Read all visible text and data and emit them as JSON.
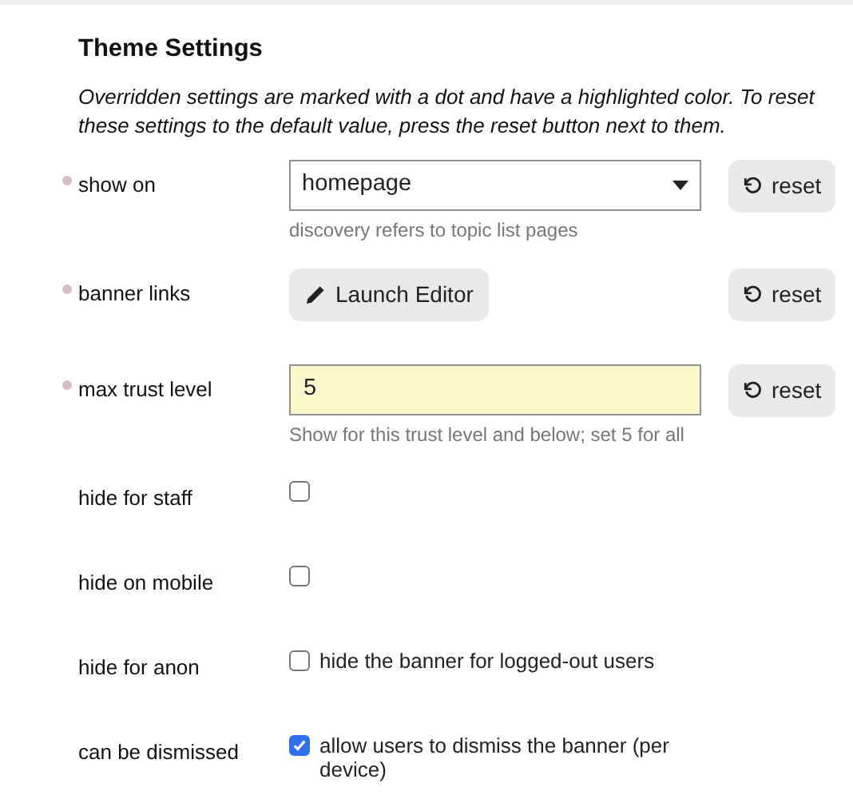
{
  "title": "Theme Settings",
  "intro": "Overridden settings are marked with a dot and have a highlighted color. To reset these settings to the default value, press the reset button next to them.",
  "settings": [
    {
      "kind": "select",
      "label": "show on",
      "overridden": true,
      "value": "homepage",
      "description": "discovery refers to topic list pages",
      "reset": "reset"
    },
    {
      "kind": "button",
      "label": "banner links",
      "overridden": true,
      "button": "Launch Editor",
      "reset": "reset"
    },
    {
      "kind": "text",
      "label": "max trust level",
      "overridden": true,
      "value": "5",
      "description": "Show for this trust level and below; set 5 for all",
      "reset": "reset"
    },
    {
      "kind": "checkbox",
      "label": "hide for staff",
      "overridden": false,
      "checked": false
    },
    {
      "kind": "checkbox",
      "label": "hide on mobile",
      "overridden": false,
      "checked": false
    },
    {
      "kind": "checkbox",
      "label": "hide for anon",
      "overridden": false,
      "checked": false,
      "caption": "hide the banner for logged-out users"
    },
    {
      "kind": "checkbox",
      "label": "can be dismissed",
      "overridden": false,
      "checked": true,
      "caption": "allow users to dismiss the banner (per device)"
    }
  ]
}
